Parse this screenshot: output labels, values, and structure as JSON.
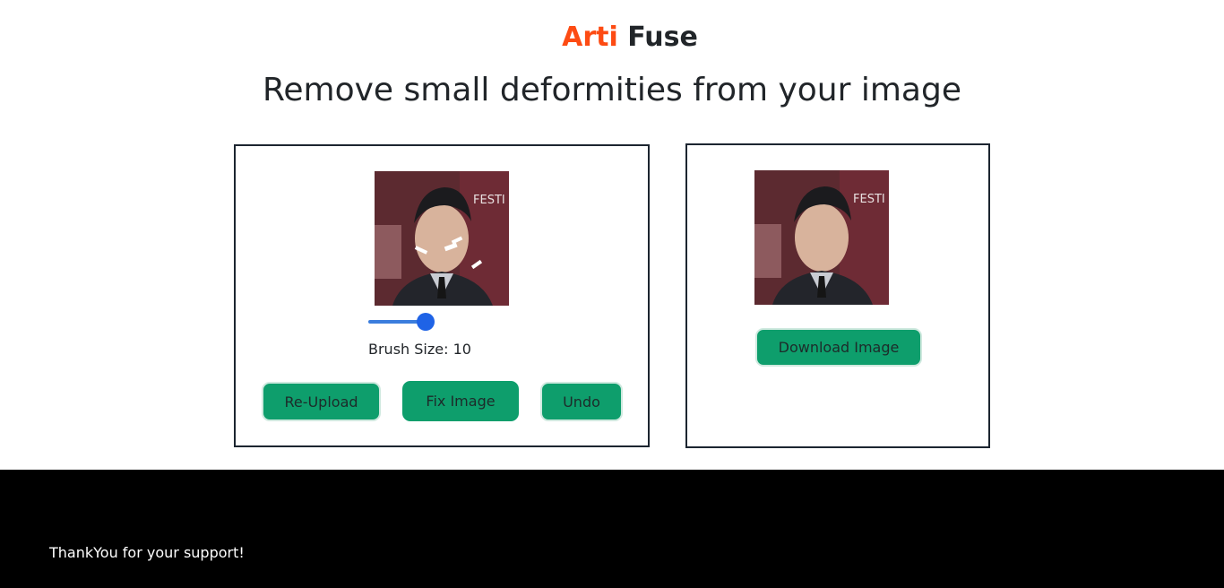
{
  "brand": {
    "part1": "Arti",
    "part2": "Fuse"
  },
  "headline": "Remove small deformities from your image",
  "editor": {
    "brush_size_value": 10,
    "brush_size_label": "Brush Size: 10",
    "buttons": {
      "reupload": "Re-Upload",
      "fix": "Fix Image",
      "undo": "Undo"
    }
  },
  "result": {
    "download_label": "Download Image"
  },
  "footer": {
    "text": "ThankYou for your support!"
  },
  "colors": {
    "brand_accent": "#fd4b13",
    "button_green": "#0e9e6c",
    "slider_blue": "#1f63e6",
    "footer_bg": "#000000"
  }
}
